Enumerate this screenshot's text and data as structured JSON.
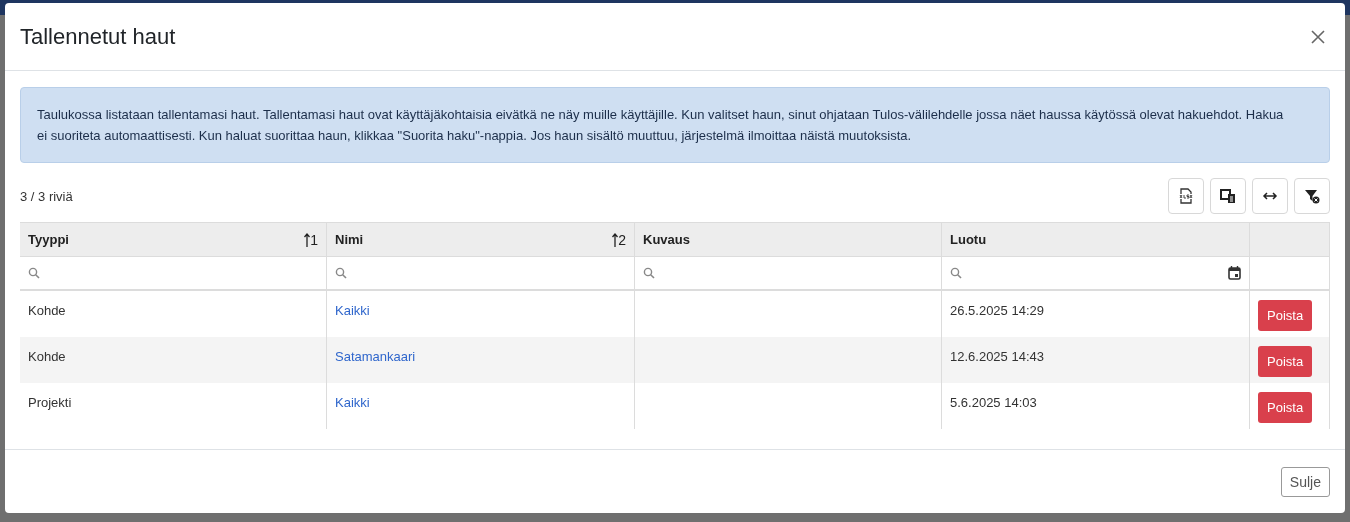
{
  "dialog": {
    "title": "Tallennetut haut",
    "info": "Taulukossa listataan tallentamasi haut. Tallentamasi haut ovat käyttäjäkohtaisia eivätkä ne näy muille käyttäjille. Kun valitset haun, sinut ohjataan Tulos-välilehdelle jossa näet haussa käytössä olevat hakuehdot. Hakua ei suoriteta automaattisesti. Kun haluat suorittaa haun, klikkaa \"Suorita haku\"-nappia. Jos haun sisältö muuttuu, järjestelmä ilmoittaa näistä muutoksista.",
    "row_count": "3 / 3 riviä",
    "toolbar": [
      {
        "kind": "xlsx"
      },
      {
        "kind": "columns"
      },
      {
        "kind": "width"
      },
      {
        "kind": "clear-filter"
      }
    ],
    "table": {
      "columns": [
        {
          "label": "Tyyppi",
          "sort": "1",
          "searchable": true
        },
        {
          "label": "Nimi",
          "sort": "2",
          "searchable": true
        },
        {
          "label": "Kuvaus",
          "searchable": true
        },
        {
          "label": "Luotu",
          "searchable": true,
          "date_picker": true
        },
        {
          "searchable": false
        }
      ],
      "rows": [
        {
          "tyyppi": "Kohde",
          "nimi": "Kaikki",
          "luotu": "26.5.2025 14:29",
          "action": "Poista"
        },
        {
          "tyyppi": "Kohde",
          "nimi": "Satamankaari",
          "luotu": "12.6.2025 14:43",
          "action": "Poista"
        },
        {
          "tyyppi": "Projekti",
          "nimi": "Kaikki",
          "luotu": "5.6.2025 14:03",
          "action": "Poista"
        }
      ]
    },
    "footer_button": "Sulje"
  }
}
